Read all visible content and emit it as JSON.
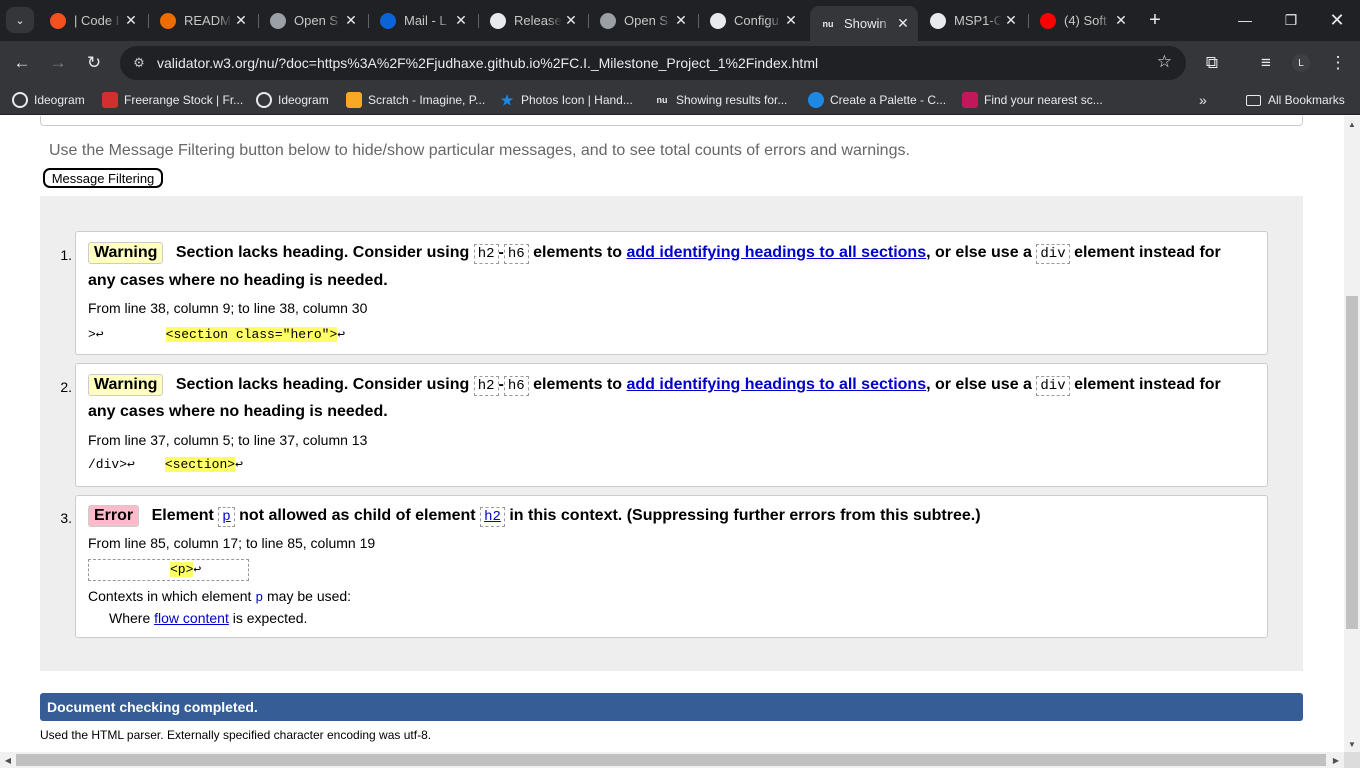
{
  "browser": {
    "tabs": [
      {
        "title": "| Code I",
        "favicon": "orange-ring-icon",
        "color": "#f4511e"
      },
      {
        "title": "READM",
        "favicon": "g-logo-icon",
        "color": "#ef6c00"
      },
      {
        "title": "Open S",
        "favicon": "globe-icon",
        "color": "#9aa0a6"
      },
      {
        "title": "Mail - L",
        "favicon": "outlook-icon",
        "color": "#0a64d6"
      },
      {
        "title": "Release",
        "favicon": "github-icon",
        "color": "#e8eaed"
      },
      {
        "title": "Open S",
        "favicon": "globe-icon",
        "color": "#9aa0a6"
      },
      {
        "title": "Configu",
        "favicon": "github-icon",
        "color": "#e8eaed"
      },
      {
        "title": "Showin",
        "favicon": "nu-icon",
        "color": "#e8eaed",
        "active": true
      },
      {
        "title": "MSP1-C",
        "favicon": "github-icon",
        "color": "#e8eaed"
      },
      {
        "title": "(4) Soft",
        "favicon": "youtube-icon",
        "color": "#ff0000"
      }
    ],
    "url": "validator.w3.org/nu/?doc=https%3A%2F%2Fjudhaxe.github.io%2FC.I._Milestone_Project_1%2Findex.html",
    "profile_initial": "L",
    "bookmarks": [
      {
        "label": "Ideogram",
        "icon": "ideogram-icon",
        "color": "#e8eaed"
      },
      {
        "label": "Freerange Stock | Fr...",
        "icon": "freerange-icon",
        "color": "#d32f2f"
      },
      {
        "label": "Ideogram",
        "icon": "ideogram-icon",
        "color": "#e8eaed"
      },
      {
        "label": "Scratch - Imagine, P...",
        "icon": "scratch-icon",
        "color": "#f9a825"
      },
      {
        "label": "Photos Icon | Hand...",
        "icon": "star-icon",
        "color": "#1e88e5"
      },
      {
        "label": "Showing results for...",
        "icon": "nu-icon",
        "color": "#e8eaed"
      },
      {
        "label": "Create a Palette - C...",
        "icon": "palette-icon",
        "color": "#1e88e5"
      },
      {
        "label": "Find your nearest sc...",
        "icon": "heart-icon",
        "color": "#c2185b"
      }
    ],
    "all_bookmarks_label": "All Bookmarks"
  },
  "page": {
    "intro_text": "Use the Message Filtering button below to hide/show particular messages, and to see total counts of errors and warnings.",
    "filter_button": "Message Filtering",
    "messages": [
      {
        "num": "1.",
        "type": "Warning",
        "text_a": "Section lacks heading. Consider using",
        "code1": "h2",
        "dash": "-",
        "code2": "h6",
        "text_b": "elements to",
        "link": "add identifying headings to all sections",
        "text_c": ", or else use a",
        "code3": "div",
        "text_d": "element instead for",
        "text_e": "any cases where no heading is needed.",
        "location": "From line 38, column 9; to line 38, column 30",
        "extract_pre": ">↩",
        "extract_hl": "<section class=\"hero\">",
        "extract_post": "↩"
      },
      {
        "num": "2.",
        "type": "Warning",
        "text_a": "Section lacks heading. Consider using",
        "code1": "h2",
        "dash": "-",
        "code2": "h6",
        "text_b": "elements to",
        "link": "add identifying headings to all sections",
        "text_c": ", or else use a",
        "code3": "div",
        "text_d": "element instead for",
        "text_e": "any cases where no heading is needed.",
        "location": "From line 37, column 5; to line 37, column 13",
        "extract_pre": "/div>↩",
        "extract_hl": "<section>",
        "extract_post": "↩"
      },
      {
        "num": "3.",
        "type": "Error",
        "text_a": "Element",
        "code1": "p",
        "text_b": "not allowed as child of element",
        "code2": "h2",
        "text_c": "in this context. (Suppressing further errors from this subtree.)",
        "location": "From line 85, column 17; to line 85, column 19",
        "extract_hl": "<p>",
        "extract_post": "↩",
        "contexts_a": "Contexts in which element",
        "contexts_code": "p",
        "contexts_b": "may be used:",
        "where_a": "Where",
        "where_link": "flow content",
        "where_b": "is expected."
      }
    ],
    "done_banner": "Document checking completed.",
    "parser_note": "Used the HTML parser. Externally specified character encoding was utf-8."
  }
}
